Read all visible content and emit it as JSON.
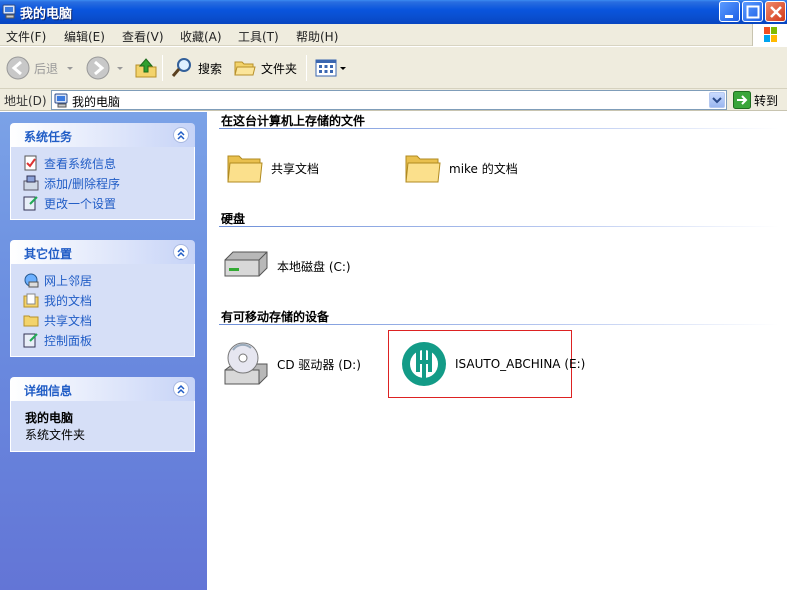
{
  "window": {
    "title": "我的电脑"
  },
  "menu": {
    "file": "文件(F)",
    "edit": "编辑(E)",
    "view": "查看(V)",
    "favorites": "收藏(A)",
    "tools": "工具(T)",
    "help": "帮助(H)"
  },
  "toolbar": {
    "back": "后退",
    "search": "搜索",
    "folders": "文件夹"
  },
  "address": {
    "label": "地址(D)",
    "value": "我的电脑",
    "go": "转到"
  },
  "panels": {
    "system_tasks": {
      "title": "系统任务",
      "items": [
        "查看系统信息",
        "添加/删除程序",
        "更改一个设置"
      ]
    },
    "other_places": {
      "title": "其它位置",
      "items": [
        "网上邻居",
        "我的文档",
        "共享文档",
        "控制面板"
      ]
    },
    "details": {
      "title": "详细信息",
      "name": "我的电脑",
      "type": "系统文件夹"
    }
  },
  "groups": {
    "stored_files": {
      "title": "在这台计算机上存储的文件",
      "items": [
        "共享文档",
        "mike 的文档"
      ]
    },
    "hard_disks": {
      "title": "硬盘",
      "items": [
        "本地磁盘 (C:)"
      ]
    },
    "removable": {
      "title": "有可移动存储的设备",
      "items": [
        "CD 驱动器 (D:)",
        "ISAUTO_ABCHINA (E:)"
      ]
    }
  },
  "colors": {
    "title_bar": "#0a55dd",
    "task_pane": "#6b8ee0",
    "link_blue": "#215dc6",
    "selection_border": "#dd2222"
  }
}
